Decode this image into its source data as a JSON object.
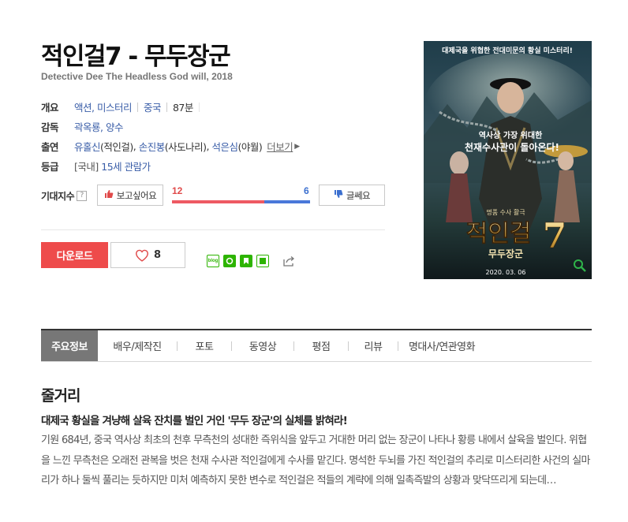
{
  "title": "적인걸7 - 무두장군",
  "subtitle": "Detective Dee The Headless God will, 2018",
  "info": {
    "overview_label": "개요",
    "genre": "액션, 미스터리",
    "country": "중국",
    "runtime": "87분",
    "director_label": "감독",
    "directors": "곽옥룡, 양수",
    "cast_label": "출연",
    "cast": [
      {
        "name": "유홀신",
        "role": "(적인걸)"
      },
      {
        "name": "손진봉",
        "role": "(사도나리)"
      },
      {
        "name": "석은심",
        "role": "(야월)"
      }
    ],
    "more_label": "더보기",
    "rating_label": "등급",
    "rating_prefix": "[국내]",
    "rating": "15세 관람가"
  },
  "expectation": {
    "label": "기대지수",
    "help": "?",
    "want_label": "보고싶어요",
    "meh_label": "글쎄요",
    "want_count": "12",
    "meh_count": "6",
    "want_ratio": 0.667,
    "want_color": "#ee5a63",
    "meh_color": "#4a78d9"
  },
  "actions": {
    "download_label": "다운로드",
    "like_count": "8"
  },
  "share": {
    "icons": [
      "blog-icon",
      "band-icon",
      "bookmark-icon",
      "line-icon",
      "share-icon"
    ],
    "blog_text": "blog"
  },
  "poster": {
    "top_text": "대제국을 위협한 전대미문의 황실 미스터리!",
    "middle_text_1": "역사상 가장 위대한",
    "middle_text_2": "천재수사관이 돌아온다!",
    "logo_small": "명품 수사 활극",
    "logo_main": "적인걸",
    "logo_number": "7",
    "logo_sub": "무두장군",
    "date": "2020. 03. 06"
  },
  "tabs": [
    {
      "label": "주요정보",
      "active": true
    },
    {
      "label": "배우/제작진",
      "active": false
    },
    {
      "label": "포토",
      "active": false
    },
    {
      "label": "동영상",
      "active": false
    },
    {
      "label": "평점",
      "active": false
    },
    {
      "label": "리뷰",
      "active": false
    },
    {
      "label": "명대사/연관영화",
      "active": false
    }
  ],
  "synopsis": {
    "title": "줄거리",
    "tagline": "대제국 황실을 겨냥해 살육 잔치를 벌인 거인 '무두 장군'의 실체를 밝혀라!",
    "body": "기원 684년, 중국 역사상 최초의 천후 무측천의 성대한 즉위식을 앞두고 거대한 머리 없는 장군이 나타나 황릉 내에서 살육을 벌인다. 위협을 느낀 무측천은 오래전 관복을 벗은 천재 수사관 적인걸에게 수사를 맡긴다. 명석한 두뇌를 가진 적인걸의 추리로 미스터리한 사건의 실마리가 하나 둘씩 풀리는 듯하지만 미처 예측하지 못한 변수로 적인걸은 적들의 계략에 의해 일촉즉발의 상황과 맞닥뜨리게 되는데…"
  }
}
